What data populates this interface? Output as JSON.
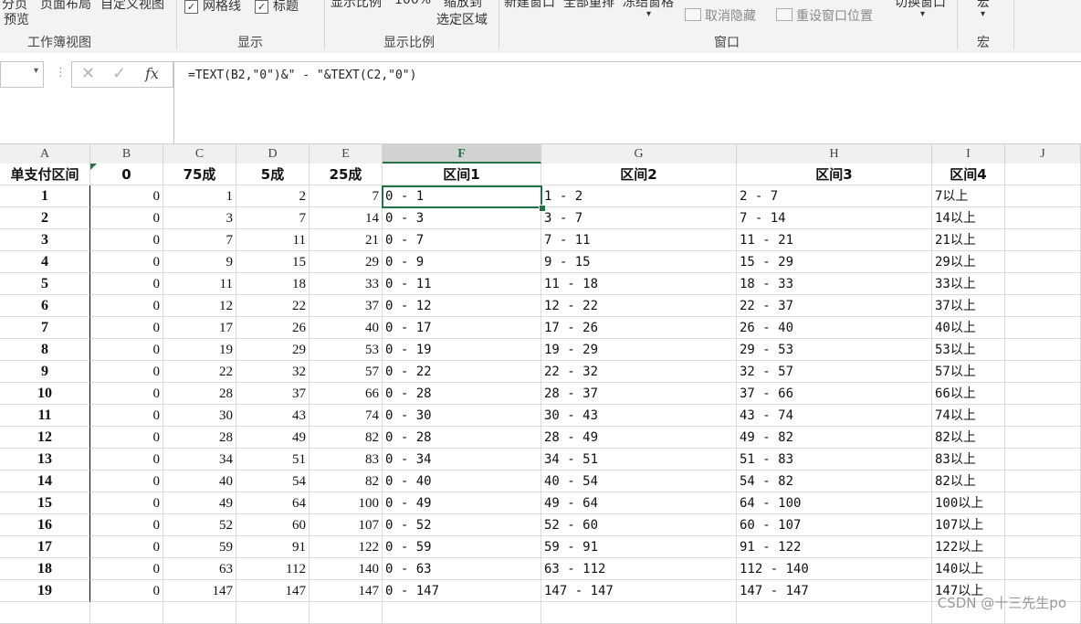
{
  "ribbon": {
    "workbook_views": {
      "label1": "分页",
      "label2": "页面布局",
      "label3": "自定义视图",
      "label4": "预览",
      "group": "工作簿视图"
    },
    "show": {
      "gridlines": "网格线",
      "headings": "标题",
      "group": "显示"
    },
    "zoom": {
      "zoom": "显示比例",
      "hundred": "100%",
      "selection1": "缩放到",
      "selection2": "选定区域",
      "group": "显示比例"
    },
    "window": {
      "new": "新建窗口",
      "arrange": "全部重排",
      "freeze": "冻结窗格",
      "unhide": "取消隐藏",
      "reset": "重设窗口位置",
      "switch": "切换窗口",
      "group": "窗口"
    },
    "macros": {
      "label": "宏",
      "group": "宏"
    }
  },
  "formula_bar": {
    "formula": "=TEXT(B2,\"0\")&\" - \"&TEXT(C2,\"0\")",
    "fx_icon": "fx-icon"
  },
  "columns": [
    "A",
    "B",
    "C",
    "D",
    "E",
    "F",
    "G",
    "H",
    "I",
    "J"
  ],
  "header_row": [
    "单支付区间",
    "0",
    "75成",
    "5成",
    "25成",
    "区间1",
    "区间2",
    "区间3",
    "区间4"
  ],
  "rows": [
    [
      "1",
      "0",
      "1",
      "2",
      "7",
      "0 - 1",
      "1 - 2",
      "2 - 7",
      "7以上"
    ],
    [
      "2",
      "0",
      "3",
      "7",
      "14",
      "0 - 3",
      "3 - 7",
      "7 - 14",
      "14以上"
    ],
    [
      "3",
      "0",
      "7",
      "11",
      "21",
      "0 - 7",
      "7 - 11",
      "11 - 21",
      "21以上"
    ],
    [
      "4",
      "0",
      "9",
      "15",
      "29",
      "0 - 9",
      "9 - 15",
      "15 - 29",
      "29以上"
    ],
    [
      "5",
      "0",
      "11",
      "18",
      "33",
      "0 - 11",
      "11 - 18",
      "18 - 33",
      "33以上"
    ],
    [
      "6",
      "0",
      "12",
      "22",
      "37",
      "0 - 12",
      "12 - 22",
      "22 - 37",
      "37以上"
    ],
    [
      "7",
      "0",
      "17",
      "26",
      "40",
      "0 - 17",
      "17 - 26",
      "26 - 40",
      "40以上"
    ],
    [
      "8",
      "0",
      "19",
      "29",
      "53",
      "0 - 19",
      "19 - 29",
      "29 - 53",
      "53以上"
    ],
    [
      "9",
      "0",
      "22",
      "32",
      "57",
      "0 - 22",
      "22 - 32",
      "32 - 57",
      "57以上"
    ],
    [
      "10",
      "0",
      "28",
      "37",
      "66",
      "0 - 28",
      "28 - 37",
      "37 - 66",
      "66以上"
    ],
    [
      "11",
      "0",
      "30",
      "43",
      "74",
      "0 - 30",
      "30 - 43",
      "43 - 74",
      "74以上"
    ],
    [
      "12",
      "0",
      "28",
      "49",
      "82",
      "0 - 28",
      "28 - 49",
      "49 - 82",
      "82以上"
    ],
    [
      "13",
      "0",
      "34",
      "51",
      "83",
      "0 - 34",
      "34 - 51",
      "51 - 83",
      "83以上"
    ],
    [
      "14",
      "0",
      "40",
      "54",
      "82",
      "0 - 40",
      "40 - 54",
      "54 - 82",
      "82以上"
    ],
    [
      "15",
      "0",
      "49",
      "64",
      "100",
      "0 - 49",
      "49 - 64",
      "64 - 100",
      "100以上"
    ],
    [
      "16",
      "0",
      "52",
      "60",
      "107",
      "0 - 52",
      "52 - 60",
      "60 - 107",
      "107以上"
    ],
    [
      "17",
      "0",
      "59",
      "91",
      "122",
      "0 - 59",
      "59 - 91",
      "91 - 122",
      "122以上"
    ],
    [
      "18",
      "0",
      "63",
      "112",
      "140",
      "0 - 63",
      "63 - 112",
      "112 - 140",
      "140以上"
    ],
    [
      "19",
      "0",
      "147",
      "147",
      "147",
      "0 - 147",
      "147 - 147",
      "147 - 147",
      "147以上"
    ]
  ],
  "watermark": "CSDN @十三先生po",
  "colors": {
    "accent": "#217346",
    "grid": "#dadada",
    "header_bg": "#f0f0f0"
  }
}
